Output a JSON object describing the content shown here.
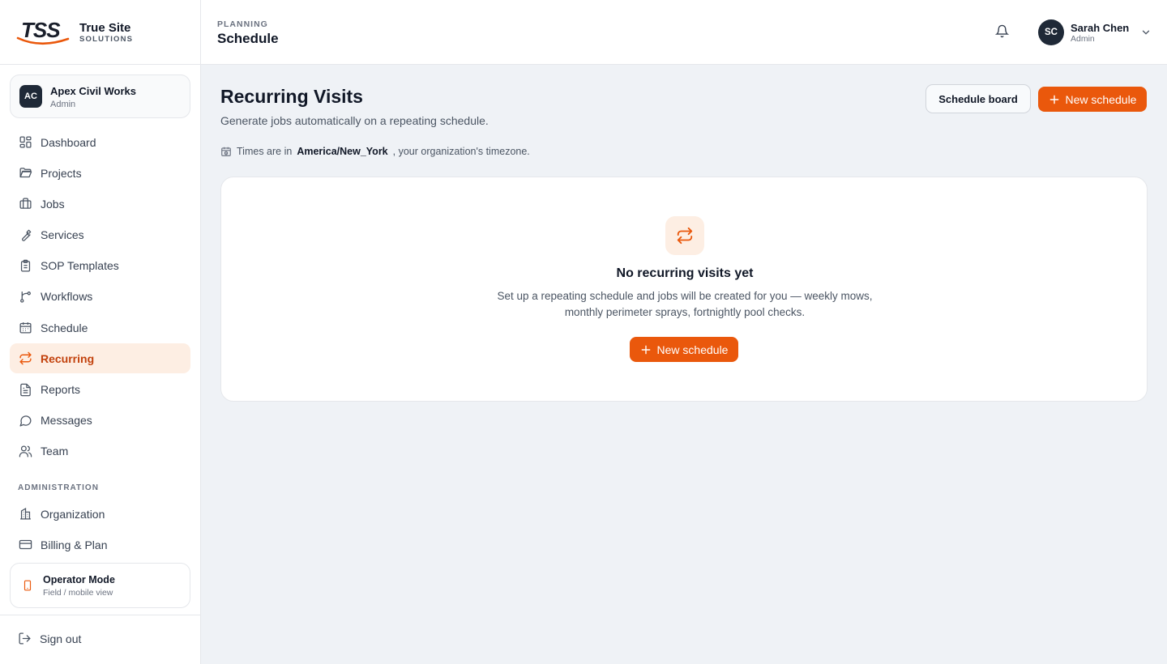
{
  "brand": {
    "mark": "TSS",
    "title": "True Site",
    "subtitle": "SOLUTIONS",
    "accent_color": "#ea580c"
  },
  "org": {
    "initials": "AC",
    "name": "Apex Civil Works",
    "role": "Admin"
  },
  "sidebar": {
    "items": [
      {
        "label": "Dashboard",
        "icon": "dashboard-icon"
      },
      {
        "label": "Projects",
        "icon": "folder-icon"
      },
      {
        "label": "Jobs",
        "icon": "briefcase-icon"
      },
      {
        "label": "Services",
        "icon": "wrench-icon"
      },
      {
        "label": "SOP Templates",
        "icon": "clipboard-icon"
      },
      {
        "label": "Workflows",
        "icon": "workflow-icon"
      },
      {
        "label": "Schedule",
        "icon": "calendar-icon"
      },
      {
        "label": "Recurring",
        "icon": "repeat-icon",
        "active": true
      },
      {
        "label": "Reports",
        "icon": "document-icon"
      },
      {
        "label": "Messages",
        "icon": "chat-icon"
      },
      {
        "label": "Team",
        "icon": "users-icon"
      }
    ],
    "admin_section_label": "ADMINISTRATION",
    "admin_items": [
      {
        "label": "Organization",
        "icon": "building-icon"
      },
      {
        "label": "Billing & Plan",
        "icon": "credit-card-icon"
      }
    ],
    "operator_mode": {
      "title": "Operator Mode",
      "subtitle": "Field / mobile view",
      "icon": "phone-icon"
    },
    "sign_out_label": "Sign out"
  },
  "header": {
    "breadcrumb": "PLANNING",
    "title": "Schedule",
    "user": {
      "initials": "SC",
      "name": "Sarah Chen",
      "role": "Admin"
    }
  },
  "main": {
    "title": "Recurring Visits",
    "subtitle": "Generate jobs automatically on a repeating schedule.",
    "timezone_prefix": "Times are in",
    "timezone": "America/New_York",
    "timezone_suffix": ", your organization's timezone.",
    "schedule_board_label": "Schedule board",
    "new_schedule_label": "New schedule",
    "empty_state": {
      "title": "No recurring visits yet",
      "description": "Set up a repeating schedule and jobs will be created for you — weekly mows, monthly perimeter sprays, fortnightly pool checks.",
      "button_label": "New schedule"
    }
  }
}
